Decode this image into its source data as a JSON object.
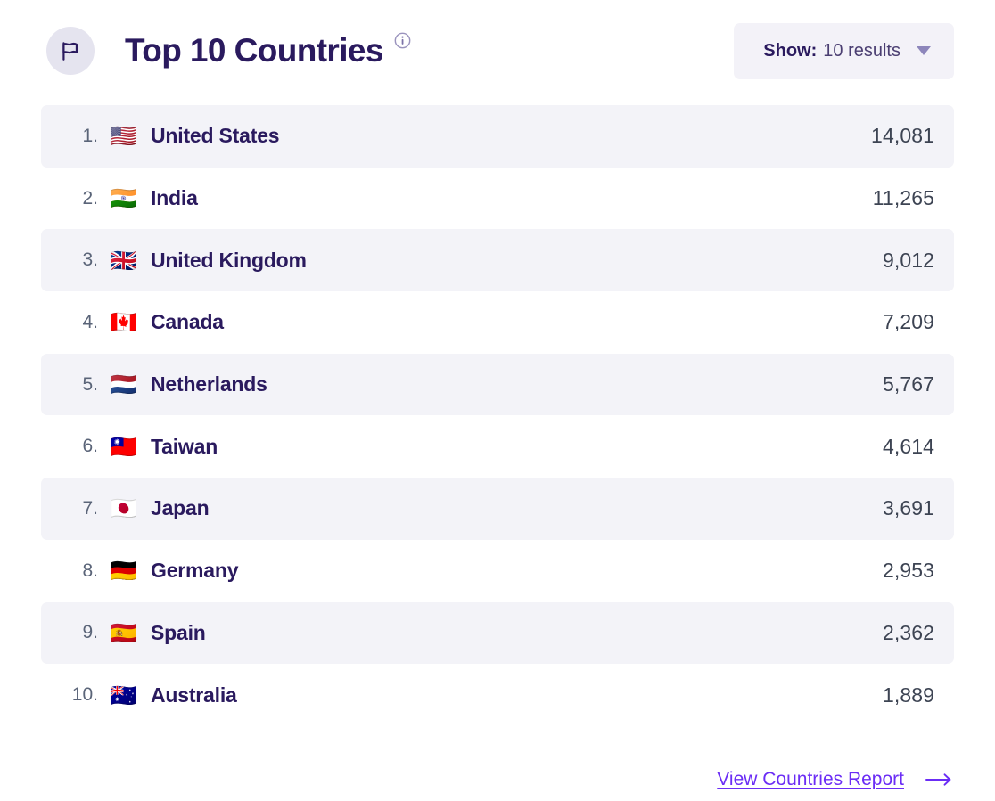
{
  "header": {
    "icon": "flag-icon",
    "title": "Top 10 Countries",
    "info_icon": "info-icon",
    "show": {
      "label": "Show:",
      "value": "10 results",
      "caret_icon": "chevron-down-icon"
    }
  },
  "list": {
    "rows": [
      {
        "rank": "1.",
        "flag": "🇺🇸",
        "country": "United States",
        "value": "14,081"
      },
      {
        "rank": "2.",
        "flag": "🇮🇳",
        "country": "India",
        "value": "11,265"
      },
      {
        "rank": "3.",
        "flag": "🇬🇧",
        "country": "United Kingdom",
        "value": "9,012"
      },
      {
        "rank": "4.",
        "flag": "🇨🇦",
        "country": "Canada",
        "value": "7,209"
      },
      {
        "rank": "5.",
        "flag": "🇳🇱",
        "country": "Netherlands",
        "value": "5,767"
      },
      {
        "rank": "6.",
        "flag": "🇹🇼",
        "country": "Taiwan",
        "value": "4,614"
      },
      {
        "rank": "7.",
        "flag": "🇯🇵",
        "country": "Japan",
        "value": "3,691"
      },
      {
        "rank": "8.",
        "flag": "🇩🇪",
        "country": "Germany",
        "value": "2,953"
      },
      {
        "rank": "9.",
        "flag": "🇪🇸",
        "country": "Spain",
        "value": "2,362"
      },
      {
        "rank": "10.",
        "flag": "🇦🇺",
        "country": "Australia",
        "value": "1,889"
      }
    ]
  },
  "footer": {
    "link_label": "View Countries Report",
    "arrow_icon": "arrow-right-icon"
  },
  "colors": {
    "title": "#2a1a5e",
    "rank": "#5a6478",
    "value": "#3d4453",
    "link": "#6b2df5",
    "row_alt_bg": "#f3f3f8",
    "chip_bg": "#f3f2f8",
    "icon_circle_bg": "#e5e4ef"
  }
}
